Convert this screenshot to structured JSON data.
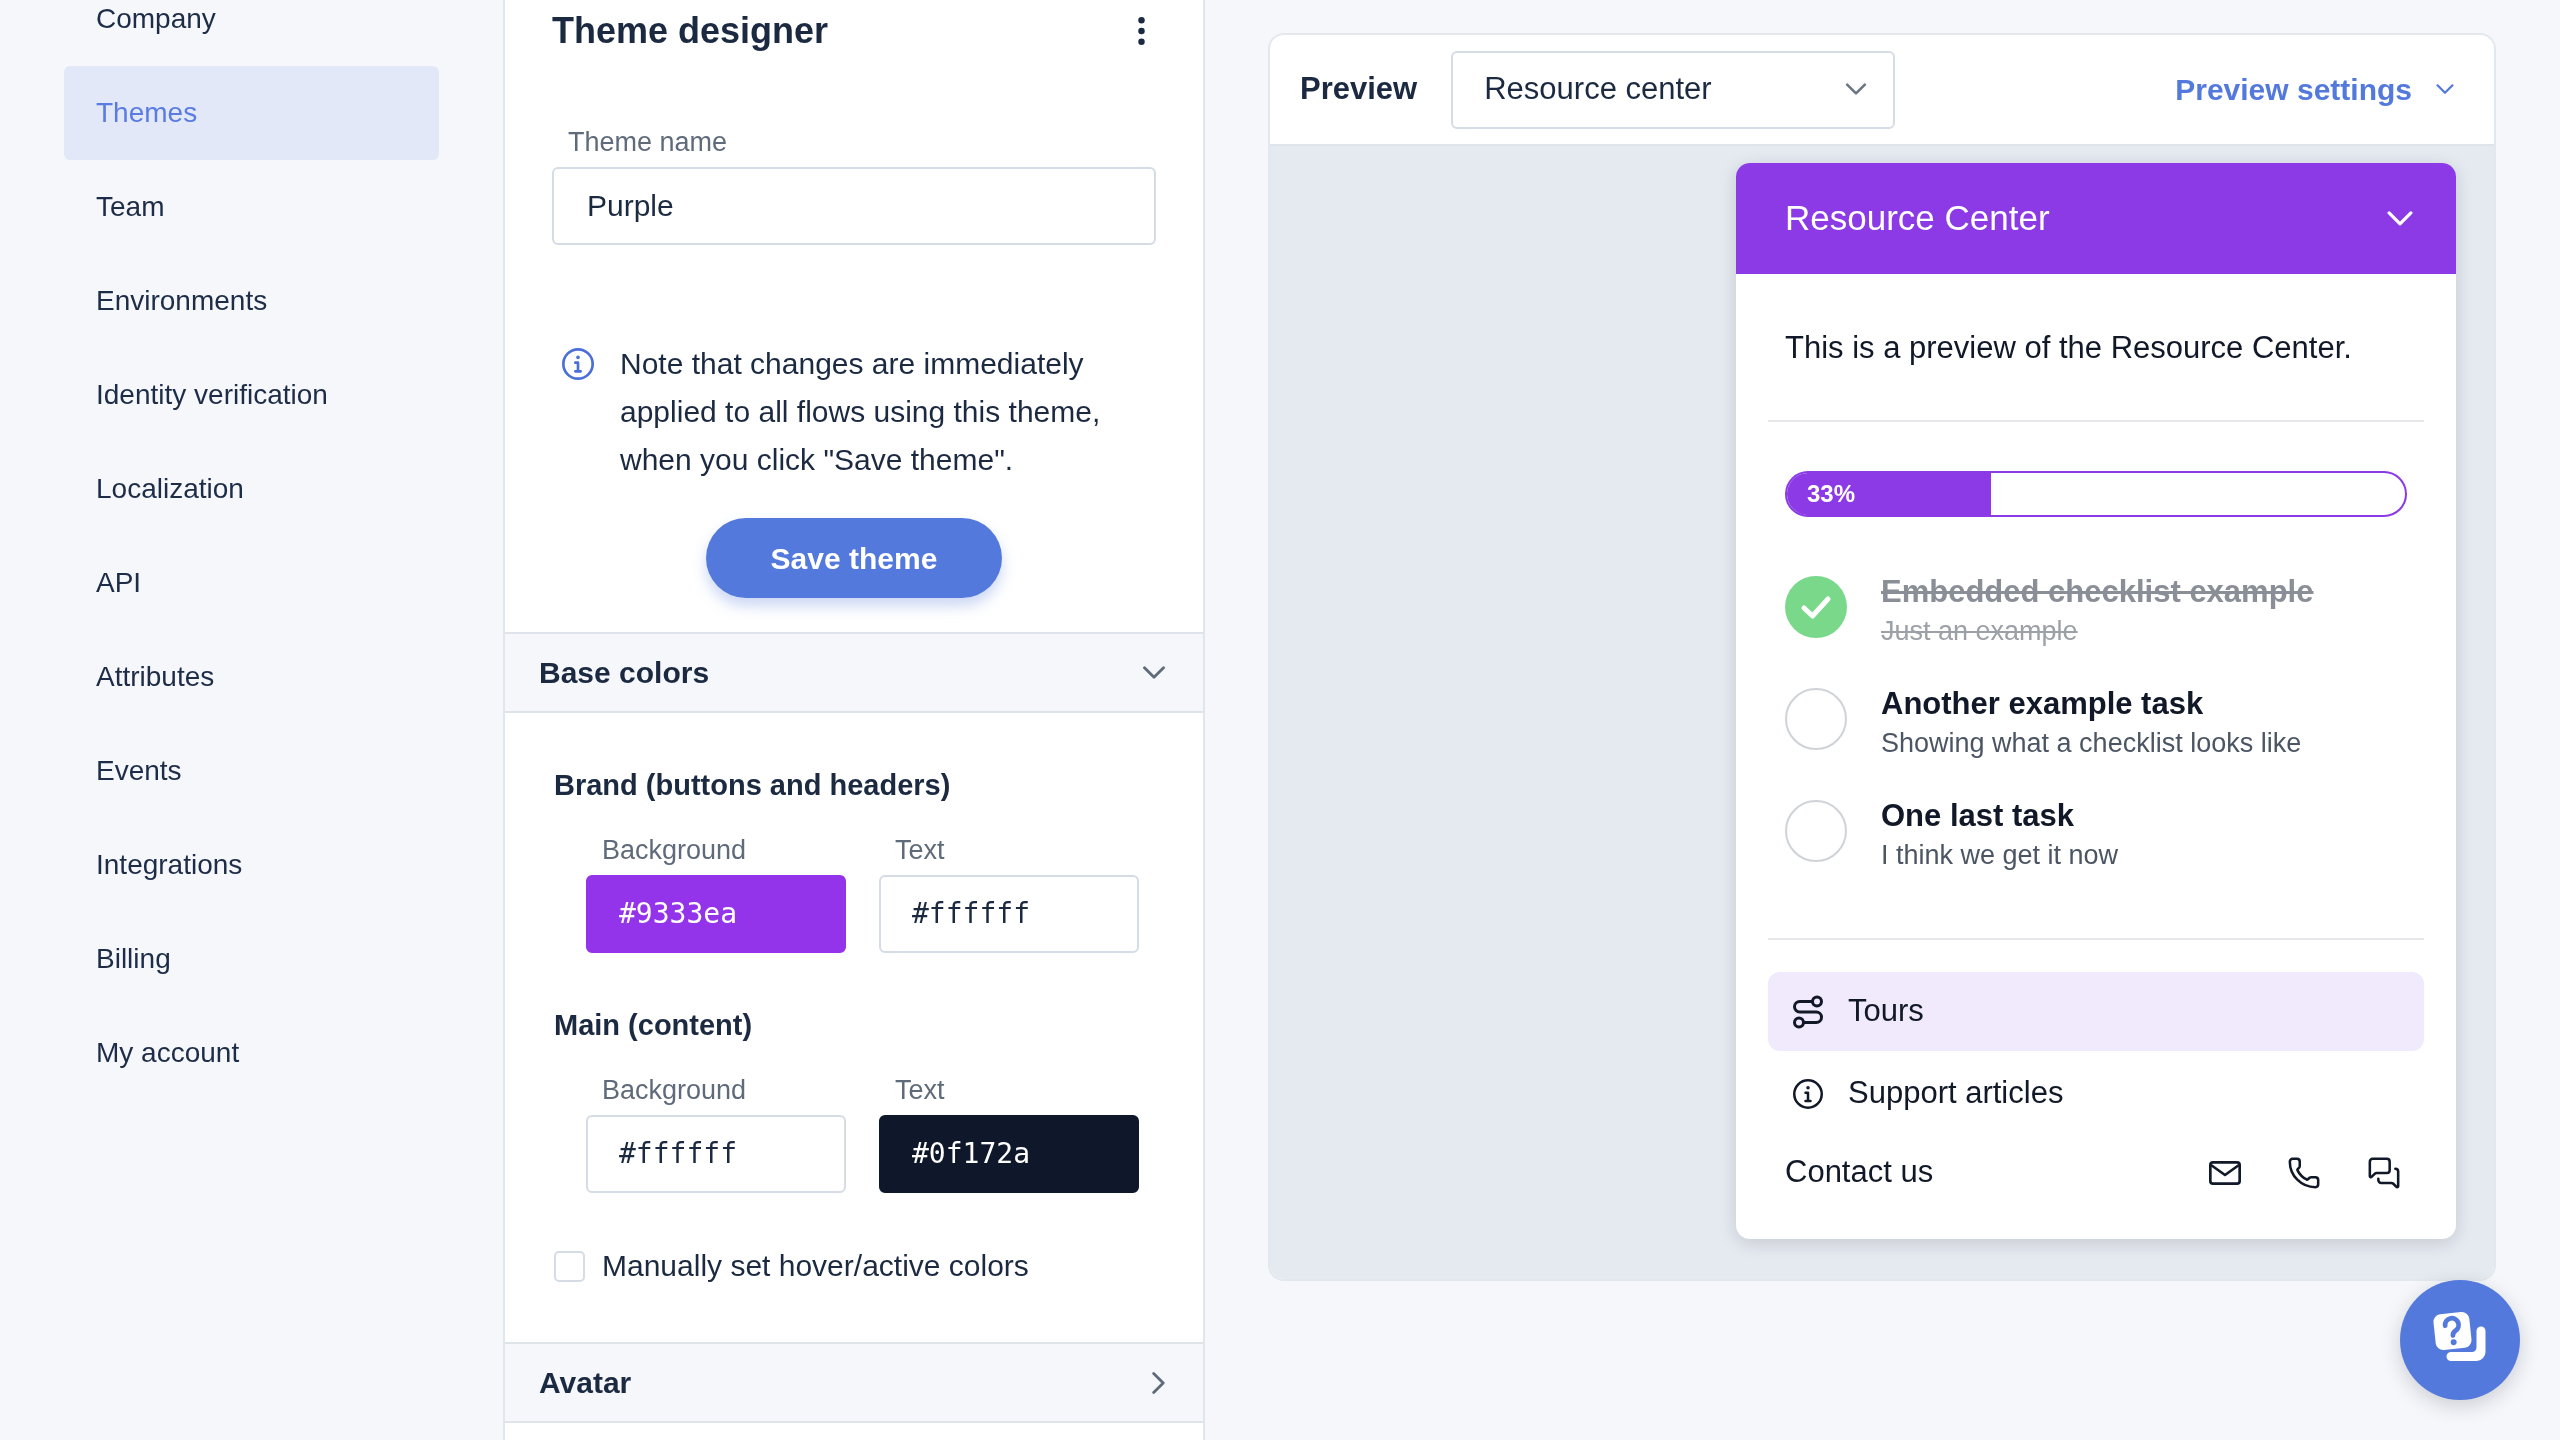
{
  "sidebar": {
    "items": [
      {
        "label": "Company",
        "selected": false
      },
      {
        "label": "Themes",
        "selected": true
      },
      {
        "label": "Team",
        "selected": false
      },
      {
        "label": "Environments",
        "selected": false
      },
      {
        "label": "Identity verification",
        "selected": false
      },
      {
        "label": "Localization",
        "selected": false
      },
      {
        "label": "API",
        "selected": false
      },
      {
        "label": "Attributes",
        "selected": false
      },
      {
        "label": "Events",
        "selected": false
      },
      {
        "label": "Integrations",
        "selected": false
      },
      {
        "label": "Billing",
        "selected": false
      },
      {
        "label": "My account",
        "selected": false
      }
    ]
  },
  "theme_designer": {
    "title": "Theme designer",
    "theme_name": {
      "label": "Theme name",
      "value": "Purple"
    },
    "note": "Note that changes are immediately applied to all flows using this theme, when you click \"Save theme\".",
    "save_button": "Save theme",
    "sections": [
      {
        "title": "Base colors",
        "expanded": true,
        "groups": [
          {
            "title": "Brand (buttons and headers)",
            "fields": [
              {
                "label": "Background",
                "value": "#9333ea",
                "color": "#9333ea"
              },
              {
                "label": "Text",
                "value": "#ffffff",
                "color": "#ffffff"
              }
            ]
          },
          {
            "title": "Main (content)",
            "fields": [
              {
                "label": "Background",
                "value": "#ffffff",
                "color": "#ffffff"
              },
              {
                "label": "Text",
                "value": "#0f172a",
                "color": "#0f172a"
              }
            ]
          }
        ],
        "checkbox": {
          "label": "Manually set hover/active colors",
          "checked": false
        }
      },
      {
        "title": "Avatar",
        "expanded": false
      }
    ]
  },
  "preview": {
    "label": "Preview",
    "select": {
      "value": "Resource center"
    },
    "settings_link": "Preview settings",
    "resource_center": {
      "title": "Resource Center",
      "intro": "This is a preview of the Resource Center.",
      "progress": {
        "level": 0.33,
        "reading": "33%"
      },
      "checklist": [
        {
          "title": "Embedded checklist example",
          "subtitle": "Just an example",
          "checked": true
        },
        {
          "title": "Another example task",
          "subtitle": "Showing what a checklist looks like",
          "checked": false
        },
        {
          "title": "One last task",
          "subtitle": "I think we get it now",
          "checked": false
        }
      ],
      "links": [
        {
          "label": "Tours",
          "kind": "tours",
          "selected": true
        },
        {
          "label": "Support articles",
          "kind": "articles",
          "selected": false
        }
      ],
      "contact": {
        "label": "Contact us"
      }
    }
  }
}
